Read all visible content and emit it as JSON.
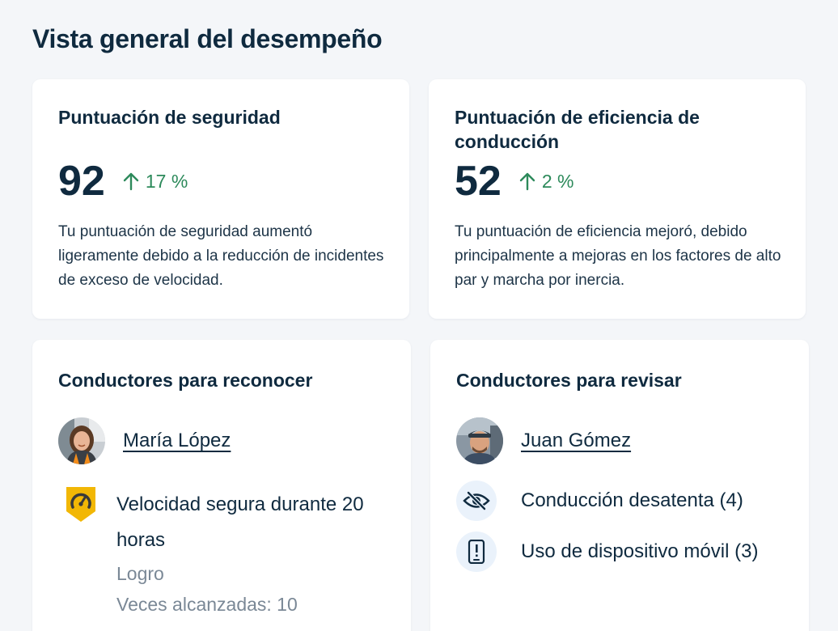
{
  "page": {
    "title": "Vista general del desempeño"
  },
  "safety": {
    "title": "Puntuación de seguridad",
    "score": "92",
    "change": "17 %",
    "trend_icon": "arrow-up-icon",
    "description": "Tu puntuación de seguridad aumentó ligeramente debido a la reducción de incidentes de exceso de velocidad."
  },
  "efficiency": {
    "title": "Puntuación de eficiencia de conducción",
    "score": "52",
    "change": "2 %",
    "trend_icon": "arrow-up-icon",
    "description": "Tu puntuación de eficiencia mejoró, debido principalmente a mejoras en los factores de alto par y marcha por inercia."
  },
  "recognize": {
    "title": "Conductores para reconocer",
    "driver": {
      "name": "María López"
    },
    "achievement": {
      "icon": "speedometer-badge-icon",
      "title": "Velocidad segura durante 20 horas",
      "type": "Logro",
      "count": "Veces alcanzadas: 10"
    }
  },
  "review": {
    "title": "Conductores para revisar",
    "driver": {
      "name": "Juan Gómez"
    },
    "issues": [
      {
        "icon": "eye-slash-icon",
        "label": "Conducción desatenta (4)"
      },
      {
        "icon": "mobile-alert-icon",
        "label": "Uso de dispositivo móvil (3)"
      }
    ]
  },
  "colors": {
    "trend_positive": "#2d8a5b",
    "badge_gold": "#f2b705",
    "issue_icon_bg": "#eaf2fb",
    "text_primary": "#0f2a3f"
  }
}
